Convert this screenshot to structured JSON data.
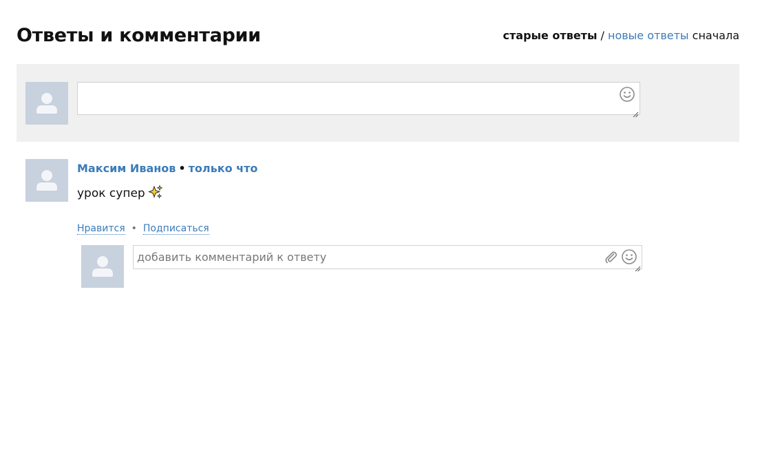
{
  "header": {
    "title": "Ответы и комментарии",
    "sort": {
      "active": "старые ответы",
      "separator": " / ",
      "other": "новые ответы",
      "suffix": " сначала"
    }
  },
  "compose": {
    "placeholder": "",
    "icons": {
      "emoji": "smiley-icon",
      "resize": "resize-handle-icon",
      "avatar": "user-avatar-icon"
    }
  },
  "answer": {
    "author": "Максим Иванов",
    "separator": "•",
    "time": "только что",
    "text": "урок супер",
    "text_emoji": "sparkles-icon",
    "actions": {
      "like": "Нравится",
      "separator": "•",
      "subscribe": "Подписаться"
    },
    "reply": {
      "placeholder": "добавить комментарий к ответу",
      "icons": {
        "attach": "paperclip-icon",
        "emoji": "smiley-icon"
      }
    }
  },
  "colors": {
    "link": "#3b7bb8",
    "compose_bg": "#f0f0f0",
    "avatar_bg": "#c8d1de",
    "sparkle": "#f6d32d"
  }
}
